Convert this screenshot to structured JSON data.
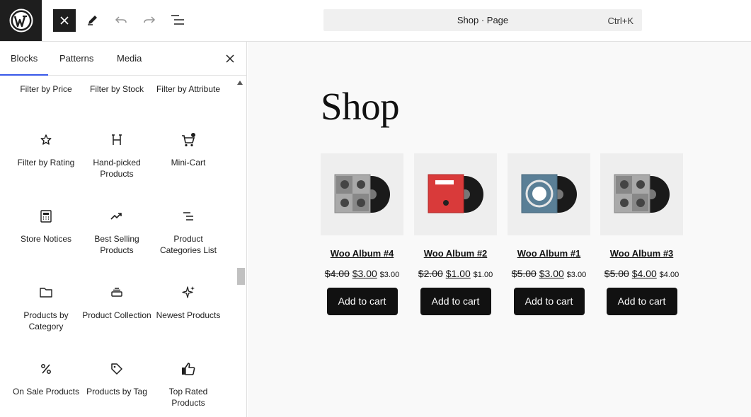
{
  "toolbar": {
    "logo_icon": "wordpress-logo-icon",
    "icons": [
      "close-icon",
      "pencil-icon",
      "undo-icon",
      "redo-icon",
      "list-view-icon"
    ],
    "command": {
      "title": "Shop · Page",
      "shortcut": "Ctrl+K"
    }
  },
  "sidebar": {
    "tabs": [
      {
        "label": "Blocks",
        "active": true
      },
      {
        "label": "Patterns",
        "active": false
      },
      {
        "label": "Media",
        "active": false
      }
    ],
    "blocks": [
      {
        "label": "Filter by Price",
        "icon": ""
      },
      {
        "label": "Filter by Stock",
        "icon": ""
      },
      {
        "label": "Filter by Attribute",
        "icon": ""
      },
      {
        "label": "Filter by Rating",
        "icon": "star-icon"
      },
      {
        "label": "Hand-picked Products",
        "icon": "hand-picked-icon"
      },
      {
        "label": "Mini-Cart",
        "icon": "cart-icon"
      },
      {
        "label": "Store Notices",
        "icon": "calculator-icon"
      },
      {
        "label": "Best Selling Products",
        "icon": "trending-up-icon"
      },
      {
        "label": "Product Categories List",
        "icon": "list-icon"
      },
      {
        "label": "Products by Category",
        "icon": "folder-icon"
      },
      {
        "label": "Product Collection",
        "icon": "stack-icon"
      },
      {
        "label": "Newest Products",
        "icon": "sparkles-icon"
      },
      {
        "label": "On Sale Products",
        "icon": "percent-icon"
      },
      {
        "label": "Products by Tag",
        "icon": "tag-icon"
      },
      {
        "label": "Top Rated Products",
        "icon": "thumbs-up-icon"
      }
    ]
  },
  "canvas": {
    "title": "Shop",
    "products": [
      {
        "name": "Woo Album #4",
        "old": "$4.00",
        "new": "$3.00",
        "small": "$3.00",
        "button": "Add to cart",
        "cover": "#a9a9a9"
      },
      {
        "name": "Woo Album #2",
        "old": "$2.00",
        "new": "$1.00",
        "small": "$1.00",
        "button": "Add to cart",
        "cover": "#d93a3a"
      },
      {
        "name": "Woo Album #1",
        "old": "$5.00",
        "new": "$3.00",
        "small": "$3.00",
        "button": "Add to cart",
        "cover": "#5a7f96"
      },
      {
        "name": "Woo Album #3",
        "old": "$5.00",
        "new": "$4.00",
        "small": "$4.00",
        "button": "Add to cart",
        "cover": "#a9a9a9"
      }
    ]
  }
}
